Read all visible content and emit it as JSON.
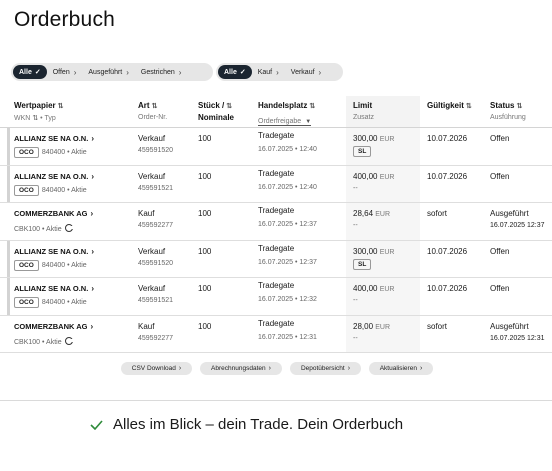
{
  "title": "Orderbuch",
  "filters": {
    "status": [
      {
        "label": "Alle",
        "active": true
      },
      {
        "label": "Offen",
        "active": false
      },
      {
        "label": "Ausgeführt",
        "active": false
      },
      {
        "label": "Gestrichen",
        "active": false
      }
    ],
    "type": [
      {
        "label": "Alle",
        "active": true
      },
      {
        "label": "Kauf",
        "active": false
      },
      {
        "label": "Verkauf",
        "active": false
      }
    ]
  },
  "columns": {
    "wertpapier": {
      "label": "Wertpapier",
      "sub": "WKN",
      "sub2": "Typ"
    },
    "art": {
      "label": "Art",
      "sub": "Order-Nr."
    },
    "stueck": {
      "label": "Stück /",
      "label2": "Nominale"
    },
    "handelsplatz": {
      "label": "Handelsplatz",
      "sub": "Orderfreigabe"
    },
    "limit": {
      "label": "Limit",
      "sub": "Zusatz"
    },
    "gueltigkeit": {
      "label": "Gültigkeit"
    },
    "status": {
      "label": "Status",
      "sub": "Ausführung"
    }
  },
  "rows": [
    {
      "name": "ALLIANZ SE NA O.N.",
      "oco": "OCO",
      "wkn": "840400",
      "typ": "Aktie",
      "art": "Verkauf",
      "order_nr": "459591520",
      "stueck": "100",
      "platz": "Tradegate",
      "freigabe": "16.07.2025 • 12:40",
      "limit": "300,00",
      "currency": "EUR",
      "zusatz": "SL",
      "gueltig": "10.07.2026",
      "status": "Offen",
      "ausfuehrung": ""
    },
    {
      "name": "ALLIANZ SE NA O.N.",
      "oco": "OCO",
      "wkn": "840400",
      "typ": "Aktie",
      "art": "Verkauf",
      "order_nr": "459591521",
      "stueck": "100",
      "platz": "Tradegate",
      "freigabe": "16.07.2025 • 12:40",
      "limit": "400,00",
      "currency": "EUR",
      "zusatz": "--",
      "gueltig": "10.07.2026",
      "status": "Offen",
      "ausfuehrung": ""
    },
    {
      "name": "COMMERZBANK AG",
      "oco": "",
      "wkn": "CBK100",
      "typ": "Aktie",
      "art": "Kauf",
      "order_nr": "459592277",
      "stueck": "100",
      "platz": "Tradegate",
      "freigabe": "16.07.2025 • 12:37",
      "limit": "28,64",
      "currency": "EUR",
      "zusatz": "--",
      "gueltig": "sofort",
      "status": "Ausgeführt",
      "ausfuehrung": "16.07.2025 12:37"
    },
    {
      "name": "ALLIANZ SE NA O.N.",
      "oco": "OCO",
      "wkn": "840400",
      "typ": "Aktie",
      "art": "Verkauf",
      "order_nr": "459591520",
      "stueck": "100",
      "platz": "Tradegate",
      "freigabe": "16.07.2025 • 12:37",
      "limit": "300,00",
      "currency": "EUR",
      "zusatz": "SL",
      "gueltig": "10.07.2026",
      "status": "Offen",
      "ausfuehrung": ""
    },
    {
      "name": "ALLIANZ SE NA O.N.",
      "oco": "OCO",
      "wkn": "840400",
      "typ": "Aktie",
      "art": "Verkauf",
      "order_nr": "459591521",
      "stueck": "100",
      "platz": "Tradegate",
      "freigabe": "16.07.2025 • 12:32",
      "limit": "400,00",
      "currency": "EUR",
      "zusatz": "--",
      "gueltig": "10.07.2026",
      "status": "Offen",
      "ausfuehrung": ""
    },
    {
      "name": "COMMERZBANK AG",
      "oco": "",
      "wkn": "CBK100",
      "typ": "Aktie",
      "art": "Kauf",
      "order_nr": "459592277",
      "stueck": "100",
      "platz": "Tradegate",
      "freigabe": "16.07.2025 • 12:31",
      "limit": "28,00",
      "currency": "EUR",
      "zusatz": "--",
      "gueltig": "sofort",
      "status": "Ausgeführt",
      "ausfuehrung": "16.07.2025 12:31"
    }
  ],
  "actions": [
    "CSV Download",
    "Abrechnungsdaten",
    "Depotübersicht",
    "Aktualisieren"
  ],
  "tagline": "Alles im Blick – dein Trade. Dein Orderbuch",
  "colors": {
    "chip_active": "#1b2530",
    "chip_bg": "#e6e6e6",
    "check": "#2e8b3a"
  },
  "icons": {
    "tick": "✓",
    "chevron": "›",
    "sort": "⇅",
    "sort_down": "▼"
  }
}
